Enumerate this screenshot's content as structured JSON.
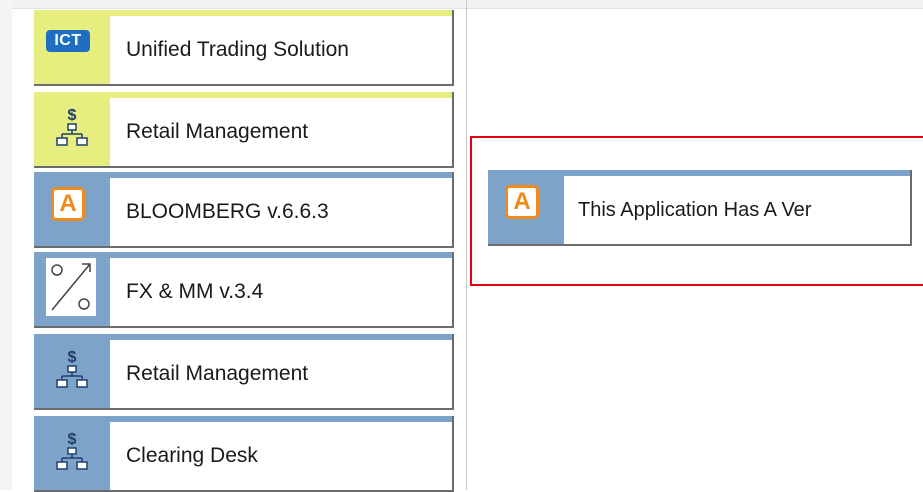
{
  "launcher": {
    "tiles": [
      {
        "label": "Unified Trading Solution",
        "icon": "ict-logo-icon",
        "icon_text": "ICT",
        "theme": "yellow"
      },
      {
        "label": "Retail Management",
        "icon": "dollar-network-icon",
        "icon_text": "$",
        "theme": "yellow"
      },
      {
        "label": "BLOOMBERG v.6.6.3",
        "icon": "a-app-icon",
        "icon_text": "A",
        "theme": "blue"
      },
      {
        "label": "FX & MM v.3.4",
        "icon": "fx-exchange-icon",
        "theme": "blue"
      },
      {
        "label": "Retail Management",
        "icon": "dollar-network-icon",
        "icon_text": "$",
        "theme": "blue"
      },
      {
        "label": "Clearing Desk",
        "icon": "dollar-network-icon",
        "icon_text": "$",
        "theme": "blue"
      }
    ]
  },
  "popup": {
    "label": "This Application Has A Ver",
    "icon": "a-app-icon",
    "icon_text": "A",
    "theme": "blue"
  },
  "colors": {
    "yellow_tile": "#e6ee80",
    "blue_tile": "#7ea3c9",
    "highlight_border": "#e3000f",
    "icon_orange": "#ef8a1c",
    "ict_blue": "#1e6fc2"
  }
}
